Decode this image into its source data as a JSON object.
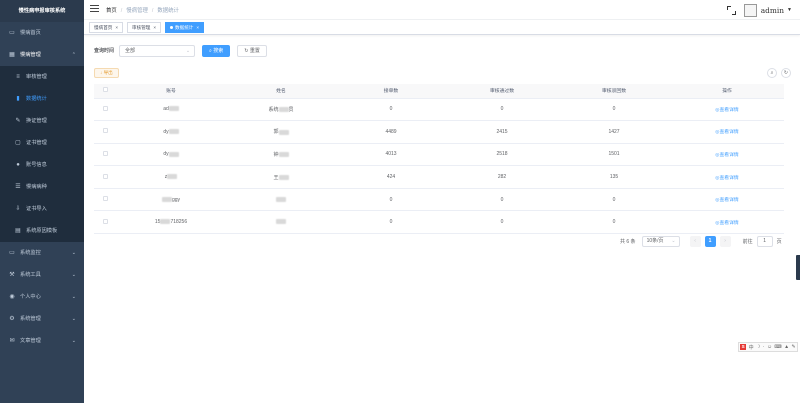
{
  "app": {
    "logo_text": "慢性病申报审核系统"
  },
  "sidebar": {
    "items": [
      {
        "label": "慢病首页",
        "icon": "monitor-icon",
        "level": 1
      },
      {
        "label": "慢病管理",
        "icon": "building-icon",
        "level": 1,
        "open": true
      },
      {
        "label": "审核管理",
        "icon": "list-icon",
        "level": 2
      },
      {
        "label": "数据统计",
        "icon": "chart-icon",
        "level": 2,
        "active": true
      },
      {
        "label": "换证管理",
        "icon": "edit-icon",
        "level": 2
      },
      {
        "label": "证书管理",
        "icon": "certificate-icon",
        "level": 2
      },
      {
        "label": "账号信息",
        "icon": "user-icon",
        "level": 2
      },
      {
        "label": "慢病病种",
        "icon": "menu-icon",
        "level": 2
      },
      {
        "label": "证书导入",
        "icon": "import-icon",
        "level": 2
      },
      {
        "label": "系统原因模板",
        "icon": "template-icon",
        "level": 2
      },
      {
        "label": "系统监控",
        "icon": "monitor-icon",
        "level": 1,
        "arrow": true
      },
      {
        "label": "系统工具",
        "icon": "tool-icon",
        "level": 1,
        "arrow": true
      },
      {
        "label": "个人中心",
        "icon": "person-icon",
        "level": 1,
        "arrow": true
      },
      {
        "label": "系统管理",
        "icon": "gear-icon",
        "level": 1,
        "arrow": true
      },
      {
        "label": "文章管理",
        "icon": "article-icon",
        "level": 1,
        "arrow": true
      }
    ]
  },
  "navbar": {
    "breadcrumb": [
      "首页",
      "慢病管理",
      "数据统计"
    ],
    "username": "admin"
  },
  "tags": [
    {
      "label": "慢病首页",
      "active": false
    },
    {
      "label": "审核管理",
      "active": false
    },
    {
      "label": "数据统计",
      "active": true
    }
  ],
  "search": {
    "label": "查询时间",
    "select_value": "全部",
    "search_label": "搜索",
    "reset_label": "重置"
  },
  "toolbar": {
    "export_label": "导出"
  },
  "table": {
    "columns": [
      "",
      "账号",
      "姓名",
      "接单数",
      "审核通过数",
      "审核驳回数",
      "操作"
    ],
    "rows": [
      {
        "account": "ad",
        "name": "系统",
        "name_suffix": "员",
        "orders": "0",
        "approved": "0",
        "rejected": "0",
        "action": "查看详情"
      },
      {
        "account": "dy",
        "name": "郭",
        "name_suffix": "",
        "orders": "4489",
        "approved": "2415",
        "rejected": "1427",
        "action": "查看详情"
      },
      {
        "account": "dy",
        "name": "钟",
        "name_suffix": "",
        "orders": "4013",
        "approved": "2518",
        "rejected": "1501",
        "action": "查看详情"
      },
      {
        "account": "z",
        "name": "王",
        "name_suffix": "",
        "orders": "424",
        "approved": "282",
        "rejected": "135",
        "action": "查看详情"
      },
      {
        "account": "",
        "name": "",
        "name_suffix": "",
        "orders": "0",
        "approved": "0",
        "rejected": "0",
        "action": "查看详情"
      },
      {
        "account": "15",
        "name": "",
        "name_suffix": "",
        "orders": "0",
        "approved": "0",
        "rejected": "0",
        "action": "查看详情"
      }
    ],
    "row_account_tails": [
      "",
      "",
      "",
      "",
      "ggy",
      "718256"
    ]
  },
  "pagination": {
    "total_text": "共 6 条",
    "page_size": "10条/页",
    "current_page": "1",
    "goto_label": "前往",
    "goto_value": "1",
    "page_unit": "页"
  },
  "colors": {
    "sidebar_bg": "#304156",
    "primary": "#409eff",
    "warning": "#e6a23c"
  }
}
